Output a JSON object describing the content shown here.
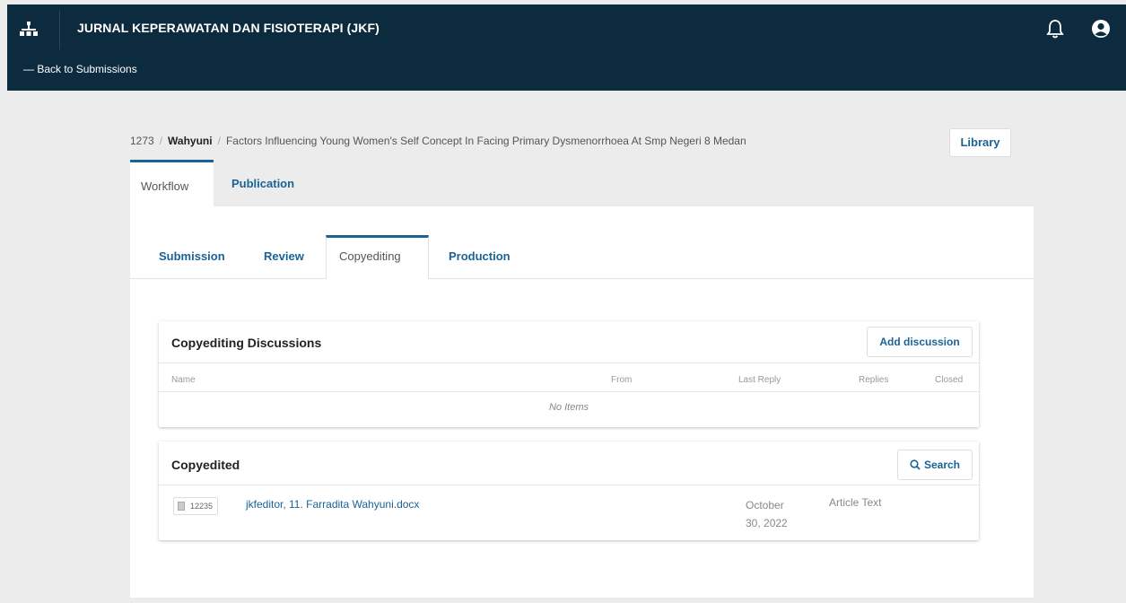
{
  "header": {
    "title": "JURNAL KEPERAWATAN DAN FISIOTERAPI (JKF)",
    "back_link": "— Back to Submissions",
    "icons": [
      "site-icon",
      "bell-icon",
      "user-icon"
    ]
  },
  "breadcrumb": {
    "id": "1273",
    "author": "Wahyuni",
    "title": "Factors Influencing Young Women's Self Concept In Facing Primary Dysmenorrhoea At Smp Negeri 8 Medan",
    "separator": "/"
  },
  "library_button": "Library",
  "main_tabs": [
    {
      "label": "Workflow",
      "active": true
    },
    {
      "label": "Publication",
      "active": false
    }
  ],
  "sub_tabs": [
    {
      "label": "Submission",
      "active": false
    },
    {
      "label": "Review",
      "active": false
    },
    {
      "label": "Copyediting",
      "active": true
    },
    {
      "label": "Production",
      "active": false
    }
  ],
  "discussions": {
    "title": "Copyediting Discussions",
    "add_button": "Add discussion",
    "columns": [
      "Name",
      "From",
      "Last Reply",
      "Replies",
      "Closed"
    ],
    "empty_text": "No Items"
  },
  "copyedited": {
    "title": "Copyedited",
    "search_button": "Search",
    "files": [
      {
        "id": "12235",
        "name": "jkfeditor, 11. Farradita Wahyuni.docx",
        "date": "October 30, 2022",
        "type": "Article Text"
      }
    ]
  },
  "colors": {
    "header_bg": "#0d2b3f",
    "link": "#1a6396",
    "page_bg": "#ececec"
  }
}
